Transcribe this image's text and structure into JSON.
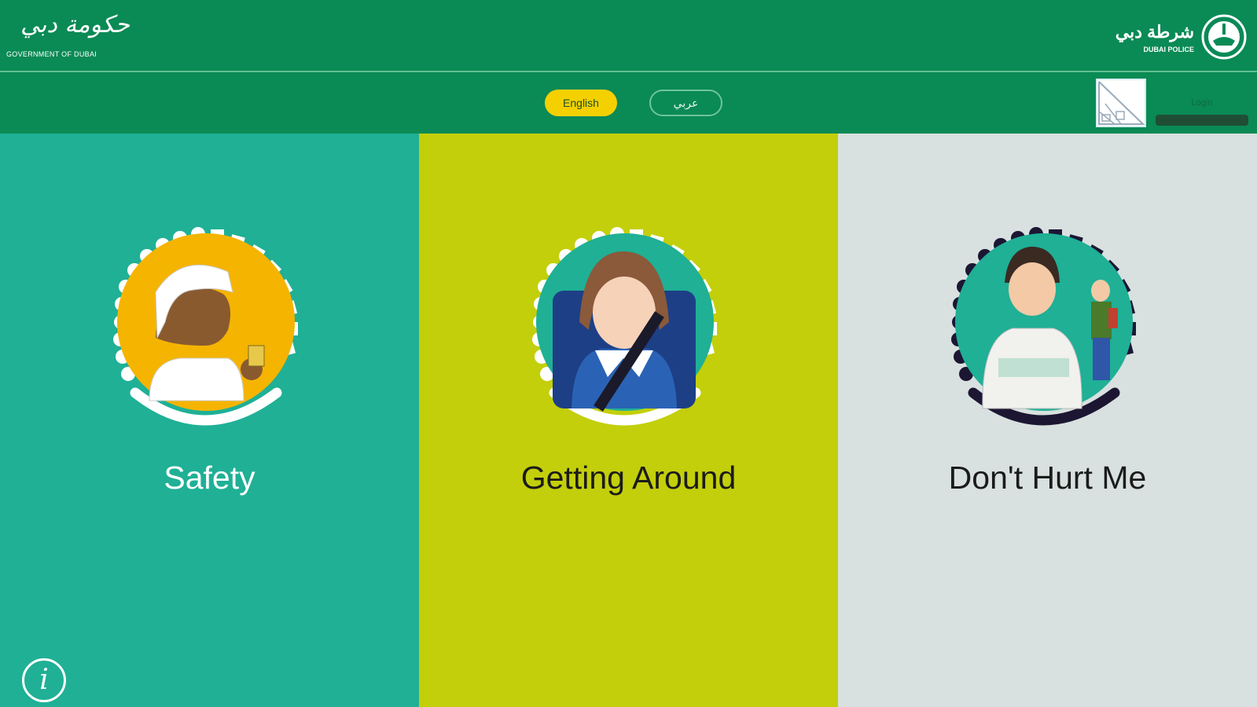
{
  "header": {
    "gov_logo_arabic": "حكومة دبي",
    "gov_logo_english": "GOVERNMENT OF DUBAI",
    "police_logo_arabic": "شرطة دبي",
    "police_logo_english": "DUBAI POLICE"
  },
  "language": {
    "english_label": "English",
    "arabic_label": "عربي",
    "selected": "English"
  },
  "user": {
    "label": "Login"
  },
  "categories": [
    {
      "title": "Safety",
      "bg": "#1fb096",
      "dots": "#ffffff",
      "inner": "#f5b400",
      "icon": "boy-in-ghutra-illustration"
    },
    {
      "title": "Getting Around",
      "bg": "#c3cf0a",
      "dots": "#ffffff",
      "inner": "#1fb096",
      "icon": "girl-with-seatbelt-illustration"
    },
    {
      "title": "Don't Hurt Me",
      "bg": "#d8e1df",
      "dots": "#1c1633",
      "inner": "#1fb096",
      "icon": "boy-and-child-illustration"
    }
  ],
  "info_icon": "i"
}
